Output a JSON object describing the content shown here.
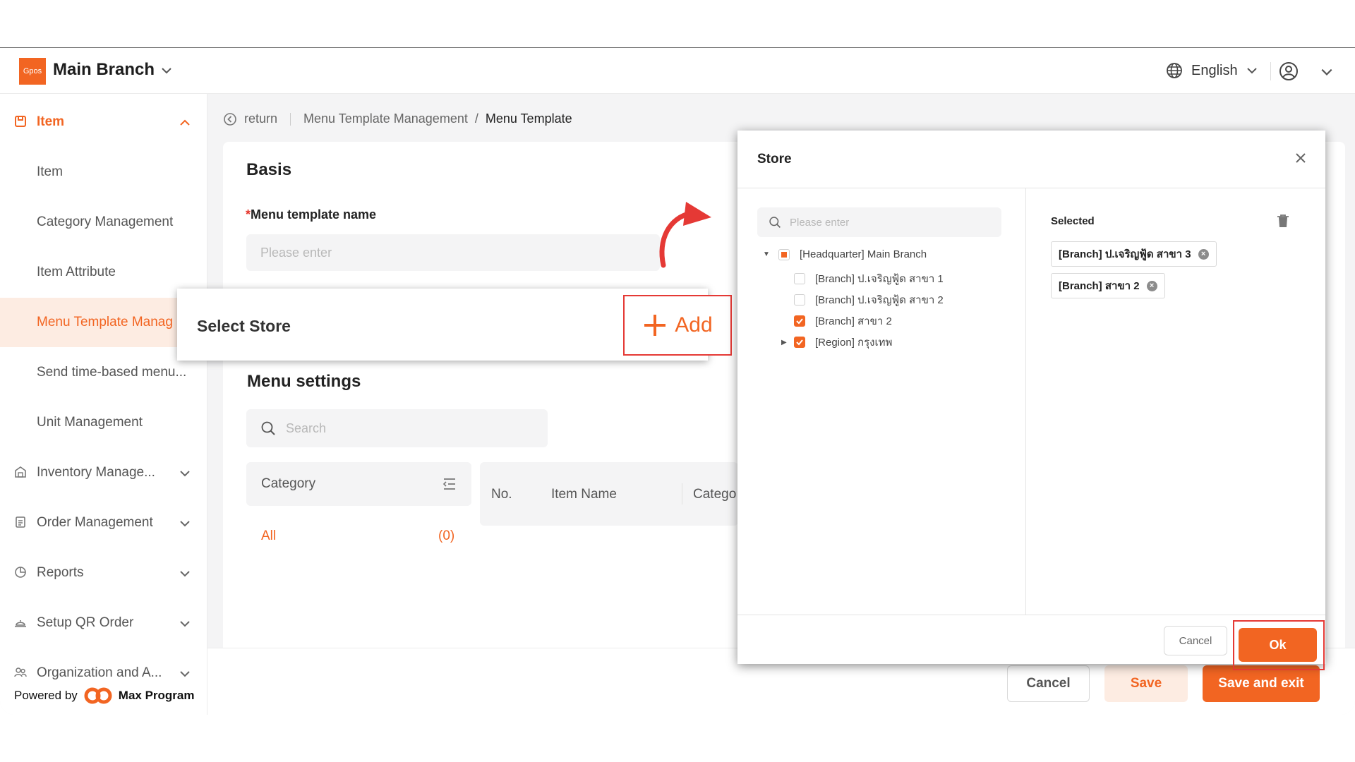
{
  "header": {
    "logo_text": "Gpos",
    "branch_name": "Main Branch",
    "language": "English"
  },
  "sidebar": {
    "parent_item": "Item",
    "items": [
      {
        "label": "Item"
      },
      {
        "label": "Category Management"
      },
      {
        "label": "Item Attribute"
      },
      {
        "label": "Menu Template Manag"
      },
      {
        "label": "Send time-based menu..."
      },
      {
        "label": "Unit Management"
      }
    ],
    "groups": [
      {
        "label": "Inventory Manage..."
      },
      {
        "label": "Order Management"
      },
      {
        "label": "Reports"
      },
      {
        "label": "Setup QR Order"
      },
      {
        "label": "Organization and A..."
      }
    ],
    "powered_by": "Powered by",
    "powered_brand": "Max Program"
  },
  "breadcrumb": {
    "return": "return",
    "parent": "Menu Template Management",
    "separator": "/",
    "current": "Menu Template"
  },
  "form": {
    "basis_title": "Basis",
    "required_mark": "*",
    "name_label": "Menu template name",
    "name_placeholder": "Please enter",
    "menu_settings_title": "Menu settings",
    "search_placeholder": "Search",
    "category_header": "Category",
    "category_all": "All",
    "category_all_count": "(0)",
    "table_columns": [
      "No.",
      "Item Name",
      "Catego"
    ]
  },
  "callout": {
    "title": "Select Store",
    "add_label": "Add"
  },
  "footer": {
    "cancel": "Cancel",
    "save": "Save",
    "save_exit": "Save and exit"
  },
  "modal": {
    "title": "Store",
    "search_placeholder": "Please enter",
    "tree": [
      {
        "label": "[Headquarter] Main Branch",
        "state": "partial"
      },
      {
        "label": "[Branch] ป.เจริญฟู้ด สาขา 1",
        "state": "unchecked"
      },
      {
        "label": "[Branch] ป.เจริญฟู้ด สาขา 2",
        "state": "unchecked"
      },
      {
        "label": "[Branch] สาขา 2",
        "state": "checked"
      },
      {
        "label": "[Region] กรุงเทพ",
        "state": "checked"
      }
    ],
    "selected_title": "Selected",
    "selected": [
      {
        "label": "[Branch] ป.เจริญฟู้ด สาขา 3"
      },
      {
        "label": "[Branch] สาขา 2"
      }
    ],
    "cancel": "Cancel",
    "ok": "Ok"
  },
  "colors": {
    "accent": "#f26522",
    "highlight_frame": "#e53935",
    "active_bg": "#fdece2"
  }
}
